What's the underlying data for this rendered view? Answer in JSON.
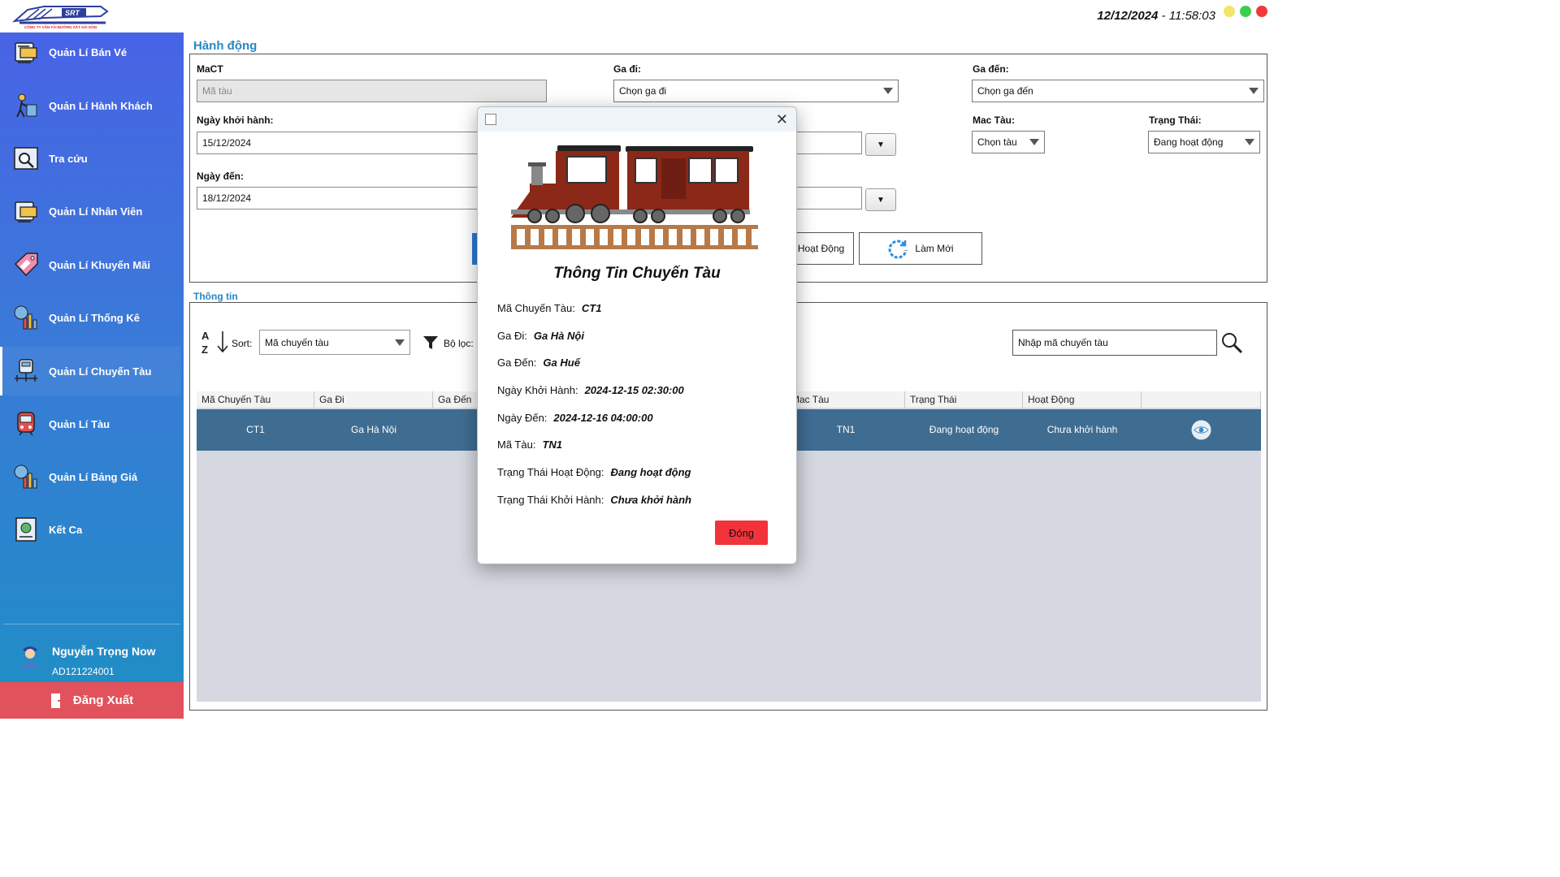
{
  "app": {
    "logo_text": "SRT",
    "logo_subtitle": "CÔNG TY VẬN TẢI ĐƯỜNG SẮT SÀI GÒN",
    "date": "12/12/2024",
    "time_sep": "-",
    "time": "11:58:03"
  },
  "colors": {
    "accent": "#2588c5",
    "sidebar_top": "#4863e6",
    "sidebar_bottom": "#1e8fc4",
    "logout": "#e2525c",
    "row_selected": "#3f6d92",
    "close_button": "#f2333b"
  },
  "sidebar": {
    "items": [
      {
        "label": "Quản Lí Bán Vé",
        "icon": "ticket-icon"
      },
      {
        "label": "Quản Lí Hành Khách",
        "icon": "passenger-icon"
      },
      {
        "label": "Tra cứu",
        "icon": "search-document-icon"
      },
      {
        "label": "Quản Lí Nhân Viên",
        "icon": "employee-icon"
      },
      {
        "label": "Quản Lí Khuyến Mãi",
        "icon": "sale-tag-icon"
      },
      {
        "label": "Quản Lí Thống Kê",
        "icon": "statistics-icon"
      },
      {
        "label": "Quản Lí Chuyến Tàu",
        "icon": "train-route-icon"
      },
      {
        "label": "Quản Lí Tàu",
        "icon": "train-icon"
      },
      {
        "label": "Quản Lí Bảng Giá",
        "icon": "price-chart-icon"
      },
      {
        "label": "Kết Ca",
        "icon": "end-shift-icon"
      }
    ],
    "active_index": 6,
    "user": {
      "name": "Nguyễn Trọng Now",
      "id": "AD121224001"
    },
    "logout_label": "Đăng Xuất"
  },
  "action": {
    "section_title": "Hành động",
    "mact_label": "MaCT",
    "mact_placeholder": "Mã tàu",
    "ga_di_label": "Ga đi:",
    "ga_di_value": "Chọn ga đi",
    "ga_den_label": "Ga đến:",
    "ga_den_value": "Chọn ga đến",
    "ngay_khoi_hanh_label": "Ngày khởi hành:",
    "ngay_khoi_hanh_value": "15/12/2024",
    "ngay_den_label": "Ngày đến:",
    "ngay_den_value": "18/12/2024",
    "dropdown_glyph": "▼",
    "mac_tau_label": "Mac Tàu:",
    "mac_tau_value": "Chọn tàu",
    "trang_thai_label": "Trạng Thái:",
    "trang_thai_value": "Đang hoạt động",
    "hoat_dong_btn": "Hoạt Động",
    "lam_moi_btn": "Làm Mới"
  },
  "info": {
    "section_title": "Thông tin",
    "sort_label": "Sort:",
    "sort_value": "Mã chuyến tàu",
    "filter_label": "Bộ lọc:",
    "search_placeholder": "Nhập mã chuyến tàu",
    "columns": [
      "Mã Chuyến Tàu",
      "Ga Đi",
      "Ga Đến",
      "",
      "",
      "Mac Tàu",
      "Trạng Thái",
      "Hoạt Động",
      ""
    ],
    "row": {
      "ma": "CT1",
      "ga_di": "Ga Hà Nội",
      "mac_tau": "TN1",
      "trang_thai": "Đang hoạt động",
      "hoat_dong": "Chưa khởi hành"
    }
  },
  "dialog": {
    "title": "Thông Tin Chuyến Tàu",
    "fields": [
      {
        "label": "Mã Chuyến Tàu:",
        "value": "CT1"
      },
      {
        "label": "Ga Đi:",
        "value": "Ga Hà Nội"
      },
      {
        "label": "Ga Đến:",
        "value": "Ga Huế"
      },
      {
        "label": "Ngày Khởi Hành:",
        "value": "2024-12-15 02:30:00"
      },
      {
        "label": "Ngày Đến:",
        "value": "2024-12-16 04:00:00"
      },
      {
        "label": "Mã Tàu:",
        "value": "TN1"
      },
      {
        "label": "Trạng Thái Hoạt Động:",
        "value": "Đang hoạt động"
      },
      {
        "label": "Trạng Thái Khởi Hành:",
        "value": "Chưa khởi hành"
      }
    ],
    "close_label": "Đóng"
  }
}
